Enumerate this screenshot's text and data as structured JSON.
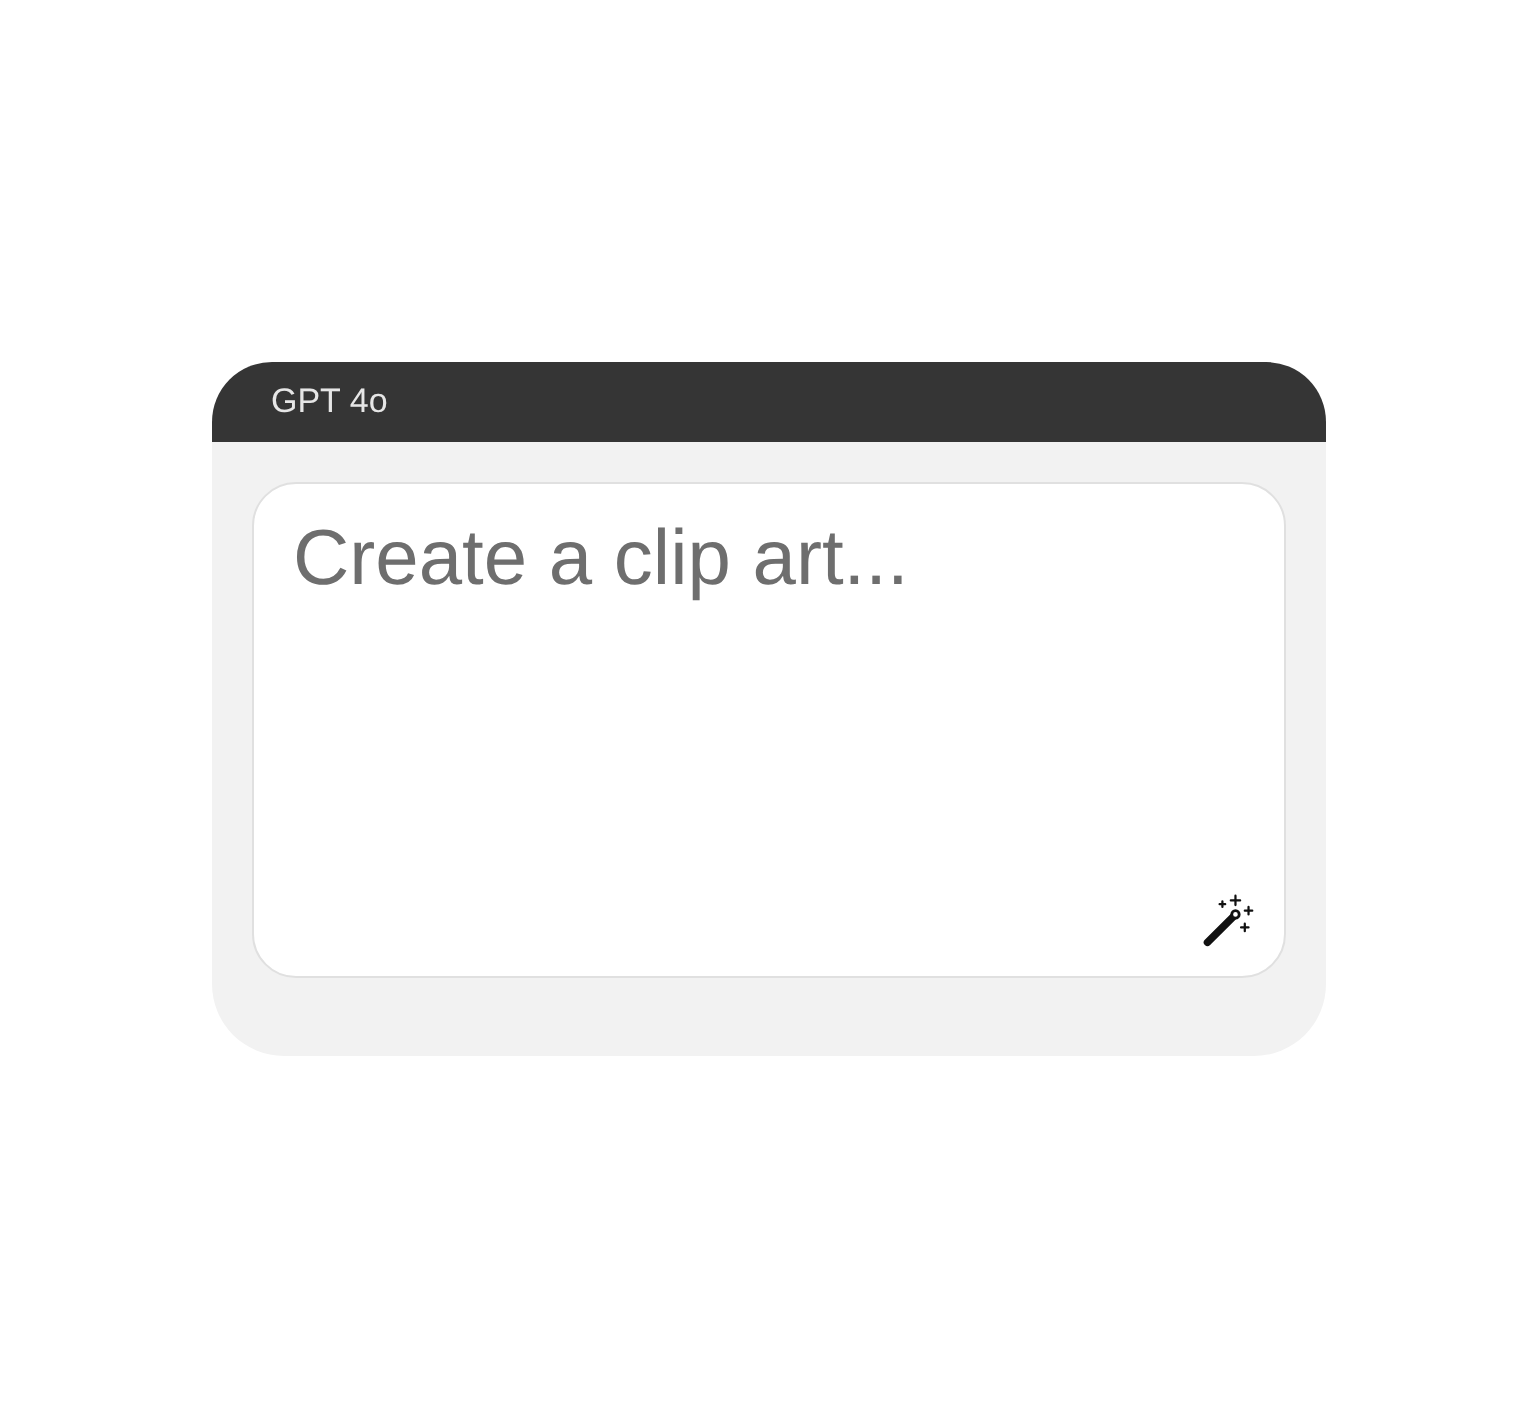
{
  "header": {
    "model": "GPT 4o"
  },
  "prompt": {
    "placeholder": "Create a clip art..."
  }
}
